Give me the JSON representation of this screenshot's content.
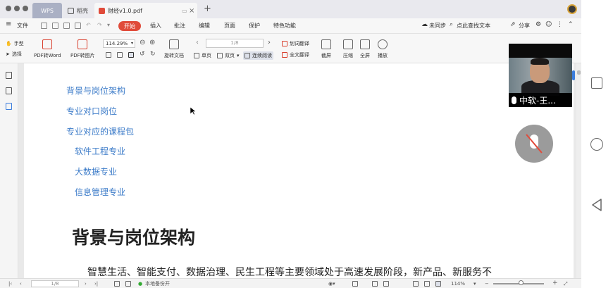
{
  "tabs": {
    "wps": "WPS",
    "docer": "稻壳",
    "document": "财经v1.0.pdf"
  },
  "menu": {
    "file": "文件",
    "start": "开始",
    "items": [
      "插入",
      "批注",
      "编辑",
      "页面",
      "保护",
      "特色功能"
    ],
    "sync": "未同步",
    "find": "点此查找文本",
    "share": "分享"
  },
  "ribbon": {
    "hand": "手型",
    "select": "选择",
    "pdf_to_word": "PDF转Word",
    "pdf_to_image": "PDF转图片",
    "zoom": "114.29%",
    "rotate": "旋转文档",
    "single_page": "单页",
    "double_page": "双页",
    "continuous": "连续阅读",
    "page_value": "1/8",
    "word_translate": "划词翻译",
    "full_translate": "全文翻译",
    "screenshot": "截屏",
    "compress": "压缩",
    "fullscreen": "全屏",
    "play": "播放"
  },
  "document": {
    "toc": [
      "背景与岗位架构",
      "专业对口岗位",
      "专业对应的课程包",
      "软件工程专业",
      "大数据专业",
      "信息管理专业"
    ],
    "heading": "背景与岗位架构",
    "body": "智慧生活、智能支付、数据治理、民生工程等主要领域处于高速发展阶段，新产品、新服务不"
  },
  "status": {
    "page": "1/8",
    "backup": "本地备份开",
    "zoom": "114%"
  },
  "video": {
    "participant": "中软-王..."
  },
  "colors": {
    "accent": "#e04b3a",
    "link": "#3d7cc9",
    "muted_slash": "#e24a3a"
  }
}
